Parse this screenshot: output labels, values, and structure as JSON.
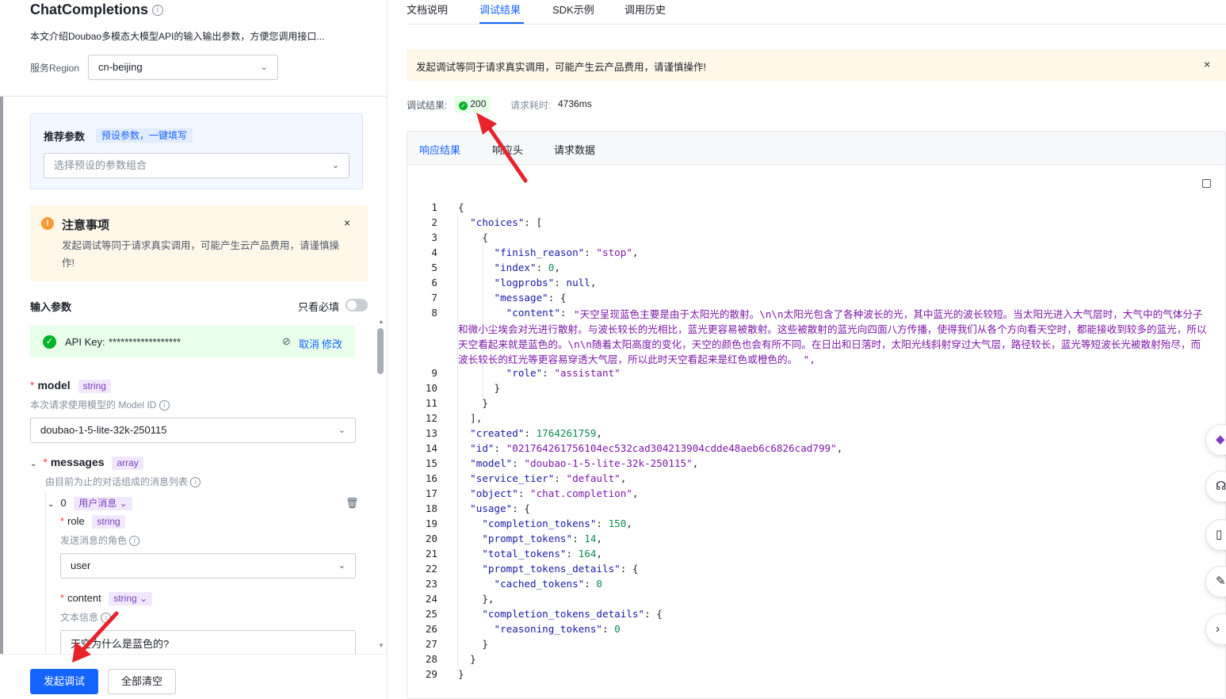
{
  "left": {
    "title": "ChatCompletions",
    "description": "本文介绍Doubao多模态大模型API的输入输出参数，方便您调用接口...",
    "region_label": "服务Region",
    "region_value": "cn-beijing",
    "preset": {
      "title": "推荐参数",
      "tag": "预设参数，一键填写",
      "placeholder": "选择预设的参数组合"
    },
    "notice": {
      "title": "注意事项",
      "text": "发起调试等同于请求真实调用，可能产生云产品费用，请谨慎操作!",
      "close": "×"
    },
    "input_params_label": "输入参数",
    "only_required_label": "只看必填",
    "api_key": {
      "label": "API Key:",
      "value": "******************",
      "cancel": "取消",
      "modify": "修改"
    },
    "model": {
      "name": "model",
      "type": "string",
      "desc": "本次请求使用模型的 Model ID",
      "value": "doubao-1-5-lite-32k-250115"
    },
    "messages": {
      "name": "messages",
      "type": "array",
      "desc": "由目前为止的对话组成的消息列表",
      "item_index": "0",
      "item_type": "用户消息",
      "role": {
        "name": "role",
        "type": "string",
        "desc": "发送消息的角色",
        "value": "user"
      },
      "content": {
        "name": "content",
        "type": "string",
        "desc": "文本信息",
        "value": "天空为什么是蓝色的?"
      }
    },
    "buttons": {
      "run": "发起调试",
      "clear": "全部清空"
    }
  },
  "right": {
    "tabs": [
      "文档说明",
      "调试结果",
      "SDK示例",
      "调用历史"
    ],
    "active_tab": "调试结果",
    "banner": "发起调试等同于请求真实调用，可能产生云产品费用，请谨慎操作!",
    "banner_close": "×",
    "result_label": "调试结果:",
    "status_code": "200",
    "time_label": "请求耗时:",
    "time_value": "4736ms",
    "sub_tabs": [
      "响应结果",
      "响应头",
      "请求数据"
    ],
    "active_sub_tab": "响应结果",
    "line_numbers": [
      "1",
      "2",
      "3",
      "4",
      "5",
      "6",
      "7",
      "8",
      "9",
      "10",
      "11",
      "12",
      "13",
      "14",
      "15",
      "16",
      "17",
      "18",
      "19",
      "20",
      "21",
      "22",
      "23",
      "24",
      "25",
      "26",
      "27",
      "28",
      "29"
    ],
    "content_text": "\"天空呈现蓝色主要是由于太阳光的散射。\\n\\n太阳光包含了各种波长的光，其中蓝光的波长较短。当太阳光进入大气层时，大气中的气体分子和微小尘埃会对光进行散射。与波长较长的光相比，蓝光更容易被散射。这些被散射的蓝光向四面八方传播，使得我们从各个方向看天空时，都能接收到较多的蓝光，所以天空看起来就是蓝色的。\\n\\n随着太阳高度的变化，天空的颜色也会有所不同。在日出和日落时，太阳光线斜射穿过大气层，路径较长，蓝光等短波长光被散射殆尽，而波长较长的红光等更容易穿透大气层，所以此时天空看起来是红色或橙色的。 \","
  },
  "colors": {
    "primary": "#1664ff",
    "success": "#00b42a",
    "warning_bg": "#fff7e8",
    "success_bg": "#e8ffea",
    "code_key": "#1a1aa6",
    "code_string": "#7f17a8",
    "code_number": "#0c8a53"
  }
}
